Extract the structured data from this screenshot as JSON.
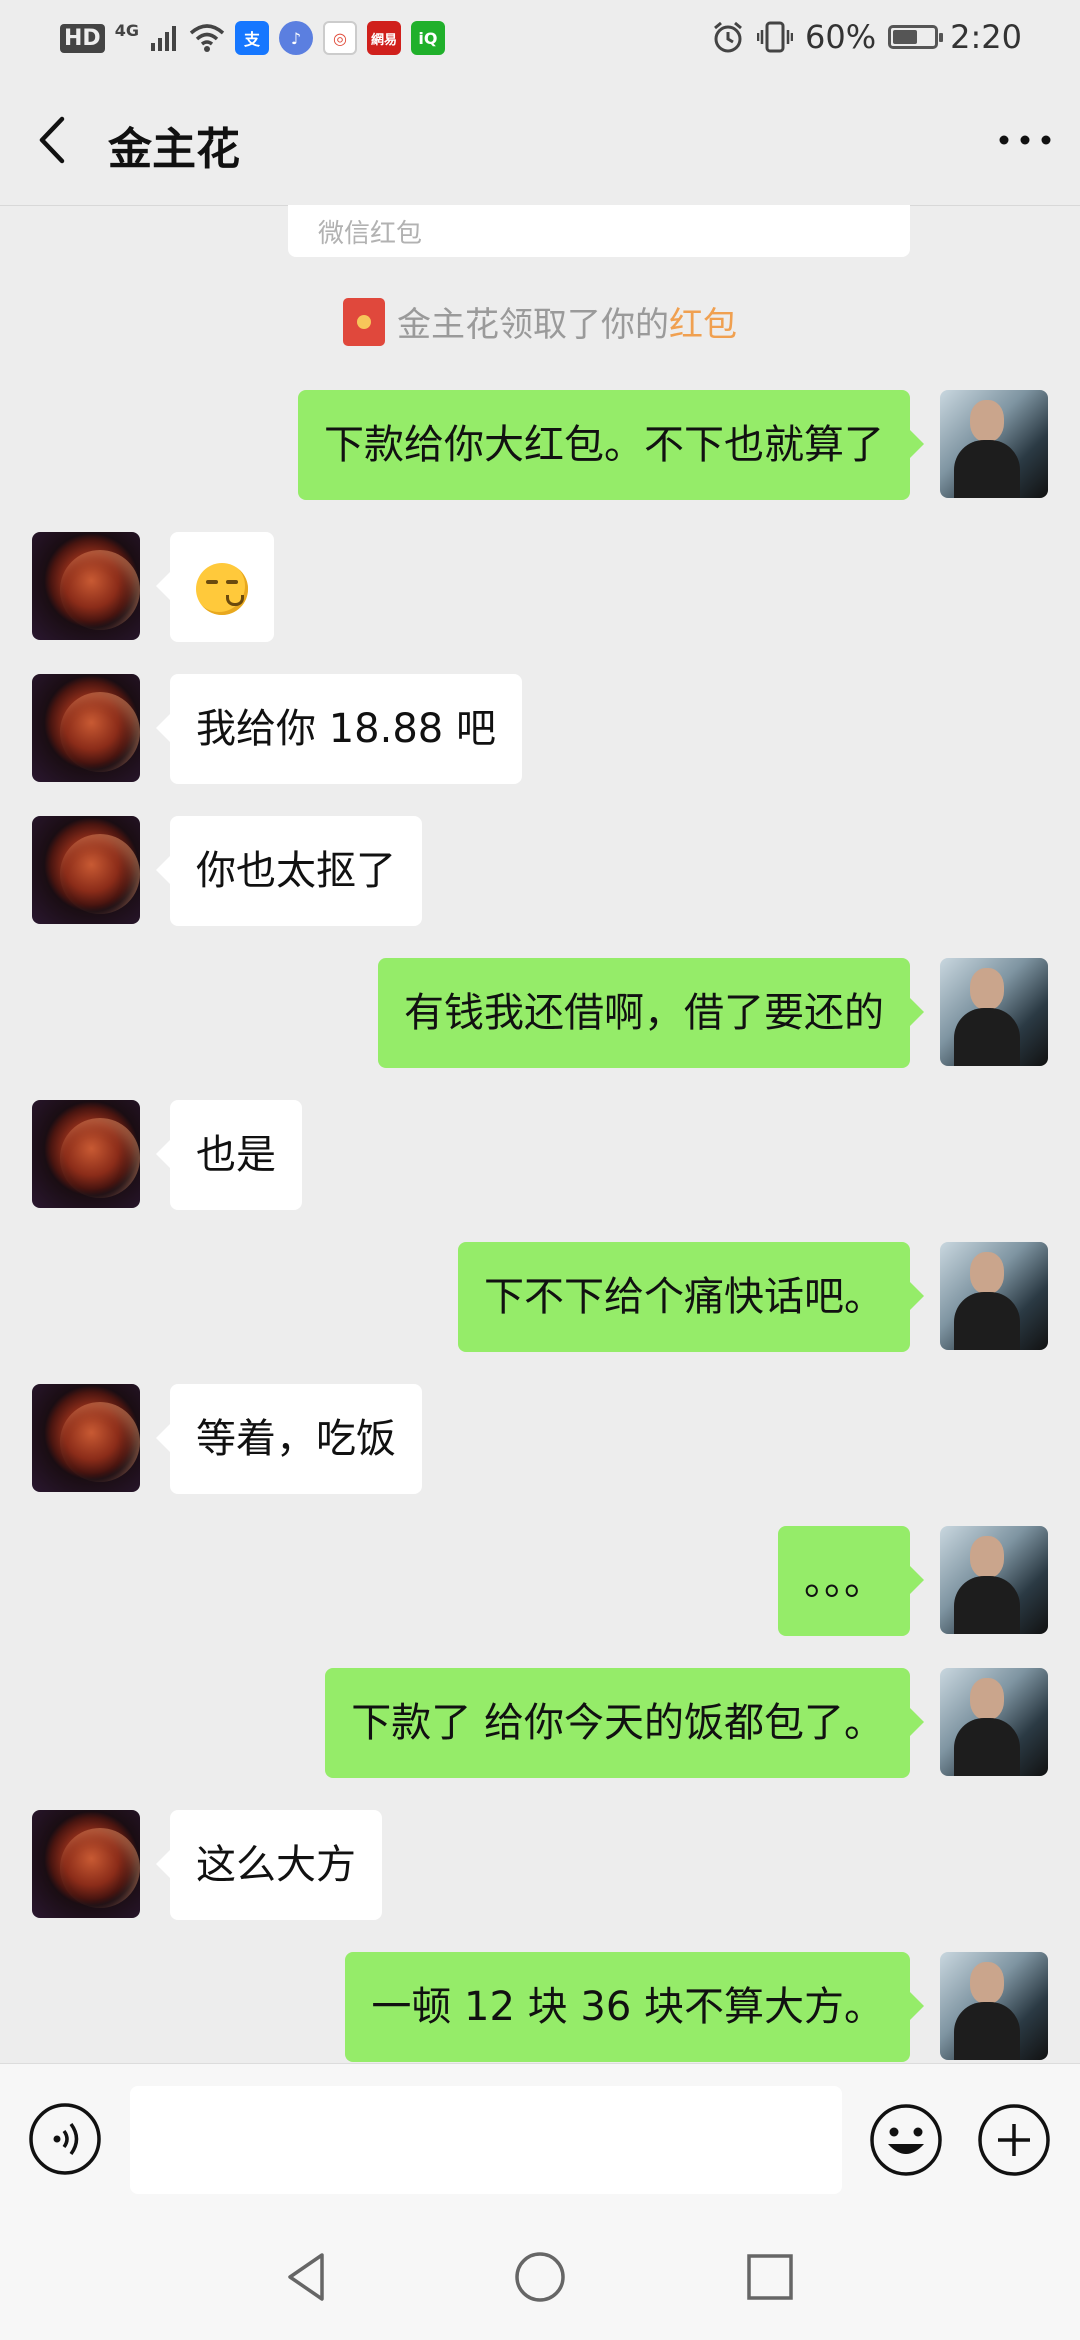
{
  "status_bar": {
    "hd": "HD",
    "network": "4G",
    "apps": [
      {
        "name": "alipay",
        "glyph": "支",
        "color": "#1677ff"
      },
      {
        "name": "music",
        "glyph": "♪",
        "color": "#5b7fe0"
      },
      {
        "name": "browser",
        "glyph": "◎",
        "color": "#e04b3a"
      },
      {
        "name": "netease",
        "glyph": "網易",
        "color": "#d0201c"
      },
      {
        "name": "iqiyi",
        "glyph": "iQ",
        "color": "#20b02b"
      }
    ],
    "battery": "60%",
    "battery_level": 0.6,
    "time": "2:20"
  },
  "header": {
    "title": "金主花"
  },
  "chat": {
    "card_stub": "微信红包",
    "system_message": {
      "text": "金主花领取了你的",
      "link": "红包"
    },
    "messages": [
      {
        "side": "right",
        "text": "下款给你大红包。不下也就算了"
      },
      {
        "side": "left",
        "text": "",
        "emoji": "smirk-emoji"
      },
      {
        "side": "left",
        "text": "我给你 18.88 吧"
      },
      {
        "side": "left",
        "text": "你也太抠了"
      },
      {
        "side": "right",
        "text": "有钱我还借啊，借了要还的"
      },
      {
        "side": "left",
        "text": "也是"
      },
      {
        "side": "right",
        "text": "下不下给个痛快话吧。"
      },
      {
        "side": "left",
        "text": "等着，吃饭"
      },
      {
        "side": "right",
        "text": "。。。"
      },
      {
        "side": "right",
        "text": "下款了  给你今天的饭都包了。"
      },
      {
        "side": "left",
        "text": "这么大方"
      },
      {
        "side": "right",
        "text": "一顿 12 块  36 块不算大方。"
      }
    ]
  },
  "input_bar": {
    "value": "",
    "icons": [
      "voice-icon",
      "emoji-icon",
      "plus-icon"
    ]
  },
  "nav_bar": {
    "icons": [
      "back-triangle-icon",
      "home-circle-icon",
      "recents-square-icon"
    ]
  },
  "colors": {
    "background": "#ededed",
    "sent_bubble": "#95ec69",
    "received_bubble": "#ffffff",
    "red_packet": "#e0483c",
    "link": "#f0a050"
  }
}
